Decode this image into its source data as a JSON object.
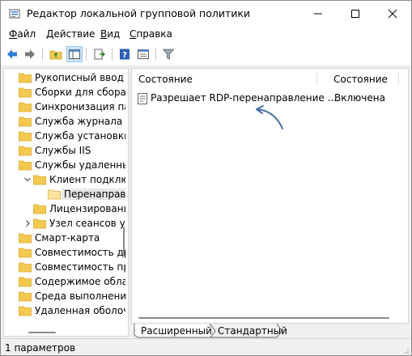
{
  "window": {
    "title": "Редактор локальной групповой политики"
  },
  "menu": {
    "items": [
      {
        "accel": "Ф",
        "rest": "айл"
      },
      {
        "accel": "Д",
        "rest": "ействие"
      },
      {
        "accel": "В",
        "rest": "ид"
      },
      {
        "accel": "С",
        "rest": "правка"
      }
    ]
  },
  "tree": {
    "items": [
      {
        "label": "Рукописный ввод",
        "expander": ""
      },
      {
        "label": "Сборки для сбора д",
        "expander": ""
      },
      {
        "label": "Синхронизация пар",
        "expander": ""
      },
      {
        "label": "Служба журнала со",
        "expander": ""
      },
      {
        "label": "Служба установки А",
        "expander": ""
      },
      {
        "label": "Службы IIS",
        "expander": ""
      },
      {
        "label": "Службы удаленных",
        "expander": ""
      },
      {
        "label": "Клиент подключ",
        "expander": "expanded"
      },
      {
        "label": "Перенаправл",
        "expander": ""
      },
      {
        "label": "Лицензировани",
        "expander": ""
      },
      {
        "label": "Узел сеансов уд",
        "expander": "collapsed"
      },
      {
        "label": "Смарт-карта",
        "expander": ""
      },
      {
        "label": "Совместимость дра",
        "expander": ""
      },
      {
        "label": "Совместимость при",
        "expander": ""
      },
      {
        "label": "Содержимое облак",
        "expander": ""
      },
      {
        "label": "Среда выполнения",
        "expander": ""
      },
      {
        "label": "Удаленная оболочк",
        "expander": ""
      }
    ]
  },
  "list": {
    "columns": [
      "Состояние",
      "Состояние"
    ],
    "rows": [
      {
        "name": "Разрешает RDP-перенаправление ...",
        "state": "Включена"
      }
    ]
  },
  "tabs": [
    "Расширенный",
    "Стандартный"
  ],
  "status": {
    "text": "1 параметров"
  },
  "colors": {
    "folder": "#f3c94f",
    "folder_dark": "#d9a92e",
    "arrow": "#4a6fa5",
    "selection": "#e6e6e6"
  }
}
